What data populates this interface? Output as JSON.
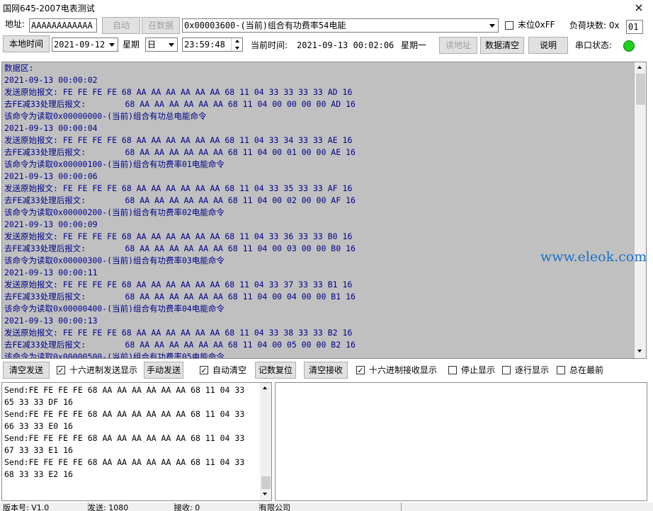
{
  "window": {
    "title": "国网645-2007电表测试",
    "close_glyph": "×"
  },
  "row1": {
    "address_label": "地址:",
    "address_value": "AAAAAAAAAAAA",
    "auto_button": "自动",
    "summon_button": "召数据",
    "command_select": "0x00003600-(当前)组合有功费率54电能",
    "last_ff_label": "末位0xFF",
    "payload_label": "负荷块数: 0x",
    "payload_value": "01"
  },
  "row2": {
    "local_time_button": "本地时间",
    "date_value": "2021-09-12",
    "weekday_label": "星期",
    "weekday_value": "日",
    "time_value": "23:59:48",
    "current_time_label": "当前时间:",
    "current_time_value": "2021-09-13  00:02:06",
    "current_weekday": "星期一",
    "read_address_button": "读地址",
    "clear_data_button": "数据清空",
    "help_button": "说明",
    "port_status_label": "串口状态:"
  },
  "data_area": {
    "lines": [
      "数据区:",
      "2021-09-13 00:00:02",
      "发送原始报文: FE FE FE FE 68 AA AA AA AA AA AA 68 11 04 33 33 33 33 AD 16",
      "去FE减33处理后报文:        68 AA AA AA AA AA AA 68 11 04 00 00 00 00 AD 16",
      "该命令为读取0x00000000-(当前)组合有功总电能命令",
      "2021-09-13 00:00:04",
      "发送原始报文: FE FE FE FE 68 AA AA AA AA AA AA 68 11 04 33 34 33 33 AE 16",
      "去FE减33处理后报文:        68 AA AA AA AA AA AA 68 11 04 00 01 00 00 AE 16",
      "该命令为读取0x00000100-(当前)组合有功费率01电能命令",
      "2021-09-13 00:00:06",
      "发送原始报文: FE FE FE FE 68 AA AA AA AA AA AA 68 11 04 33 35 33 33 AF 16",
      "去FE减33处理后报文:        68 AA AA AA AA AA AA 68 11 04 00 02 00 00 AF 16",
      "该命令为读取0x00000200-(当前)组合有功费率02电能命令",
      "2021-09-13 00:00:09",
      "发送原始报文: FE FE FE FE 68 AA AA AA AA AA AA 68 11 04 33 36 33 33 B0 16",
      "去FE减33处理后报文:        68 AA AA AA AA AA AA 68 11 04 00 03 00 00 B0 16",
      "该命令为读取0x00000300-(当前)组合有功费率03电能命令",
      "2021-09-13 00:00:11",
      "发送原始报文: FE FE FE FE 68 AA AA AA AA AA AA 68 11 04 33 37 33 33 B1 16",
      "去FE减33处理后报文:        68 AA AA AA AA AA AA 68 11 04 00 04 00 00 B1 16",
      "该命令为读取0x00000400-(当前)组合有功费率04电能命令",
      "2021-09-13 00:00:13",
      "发送原始报文: FE FE FE FE 68 AA AA AA AA AA AA 68 11 04 33 38 33 33 B2 16",
      "去FE减33处理后报文:        68 AA AA AA AA AA AA 68 11 04 00 05 00 00 B2 16",
      "该命令为读取0x00000500-(当前)组合有功费率05电能命令"
    ]
  },
  "watermark": "www.eleok.com",
  "row3": {
    "clear_send_button": "清空发送",
    "hex_send_label": "十六进制发送显示",
    "manual_send_button": "手动发送",
    "auto_clear_label": "自动清空",
    "reset_count_button": "记数复位",
    "clear_receive_button": "清空接收",
    "hex_receive_label": "十六进制接收显示",
    "stop_display_label": "停止显示",
    "line_display_label": "逐行显示",
    "always_top_label": "总在最前"
  },
  "send_area": {
    "lines": [
      "Send:FE FE FE FE 68 AA AA AA AA AA AA 68 11 04 33",
      "65 33 33 DF 16",
      "Send:FE FE FE FE 68 AA AA AA AA AA AA 68 11 04 33",
      "66 33 33 E0 16",
      "Send:FE FE FE FE 68 AA AA AA AA AA AA 68 11 04 33",
      "67 33 33 E1 16",
      "Send:FE FE FE FE 68 AA AA AA AA AA AA 68 11 04 33",
      "68 33 33 E2 16"
    ]
  },
  "statusbar": {
    "version": "版本号: V1.0",
    "send": "发送: 1080",
    "receive": "接收: 0",
    "company": "有限公司"
  },
  "colors": {
    "data_text": "#00008b",
    "data_bg": "#c0c0c0",
    "led": "#1fd11f",
    "watermark": "#1f72c8"
  }
}
